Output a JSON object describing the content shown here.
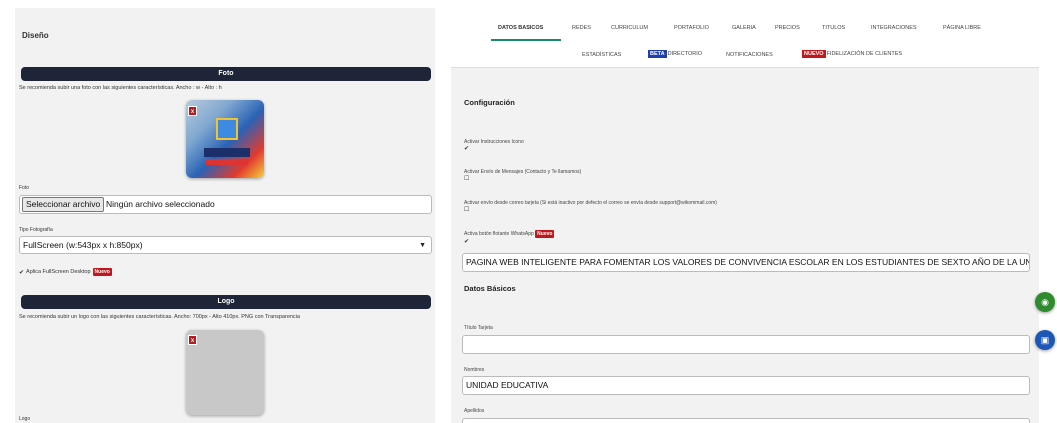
{
  "left": {
    "title": "Diseño",
    "foto_section": "Foto",
    "foto_hint": "Se recomienda subir una foto con las siguientes características. Ancho : w - Alto : h",
    "delete_label": "x",
    "foto_label": "Foto",
    "file_button": "Seleccionar archivo",
    "file_status": "Ningún archivo seleccionado",
    "tipo_label": "Tipo Fotografía",
    "tipo_value": "FullScreen (w:543px x h:850px)",
    "fullscreen_check": "Aplica FullScreen Desktop",
    "nuevo": "Nuevo",
    "logo_section": "Logo",
    "logo_hint": "Se recomienda subir un logo con las siguientes características. Ancho: 700px - Alto 410px. PNG con Transparencia",
    "logo_label": "Logo"
  },
  "tabs": {
    "row1": [
      "DATOS BASICOS",
      "REDES",
      "CURRICULUM",
      "PORTAFOLIO",
      "GALERIA",
      "PRECIOS",
      "TITULOS",
      "INTEGRACIONES",
      "PÁGINA LIBRE"
    ],
    "estadisticas": "ESTADÍSTICAS",
    "beta": "BETA",
    "directorio": "DIRECTORIO",
    "notificaciones": "NOTIFICACIONES",
    "nuevo": "NUEVO",
    "fidelizacion": "FIDELIZACIÓN DE CLIENTES"
  },
  "config": {
    "heading": "Configuración",
    "opt1": "Activar Instrucciones Icono",
    "opt2": "Activar Envío de Mensajes (Contacto y Te llamamos)",
    "opt3": "Activar envío desde correo tarjeta (Si está inactivo por defecto el correo se envía desde support@wikommail.com)",
    "opt4": "Activa botón flotante WhatsApp",
    "nuevo": "Nuevo",
    "text_value": "PAGINA WEB INTELIGENTE PARA FOMENTAR LOS VALORES DE CONVIVENCIA ESCOLAR EN LOS ESTUDIANTES DE SEXTO AÑO DE LA UNIDAD EDU"
  },
  "datos": {
    "heading": "Datos Básicos",
    "titulo_label": "Título Tarjeta",
    "titulo_value": "",
    "nombres_label": "Nombres",
    "nombres_value": "UNIDAD EDUCATIVA",
    "apellidos_label": "Apellidos"
  },
  "icons": {
    "checked": "✔",
    "unchecked": "☐",
    "dropdown": "▼",
    "eye": "◉",
    "save": "▣"
  }
}
